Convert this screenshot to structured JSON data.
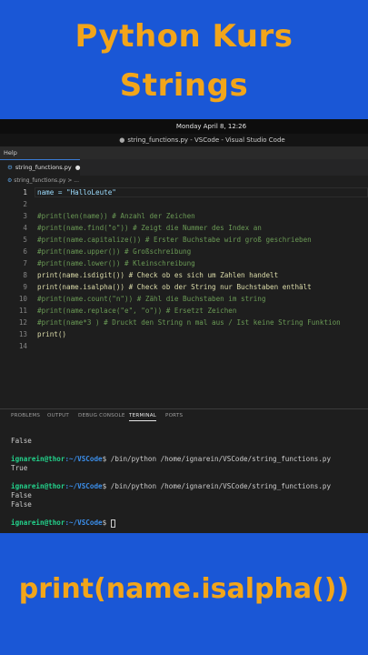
{
  "banner": {
    "line1": "Python Kurs",
    "line2": "Strings",
    "caption": "print(name.isalpha())"
  },
  "os_bar": {
    "datetime": "Monday April 8, 12:26"
  },
  "window": {
    "title": "string_functions.py - VSCode - Visual Studio Code"
  },
  "menu": {
    "help": "Help"
  },
  "tab": {
    "filename": "string_functions.py"
  },
  "breadcrumb": {
    "file": "string_functions.py > ..."
  },
  "editor": {
    "line_numbers": [
      "1",
      "2",
      "3",
      "4",
      "5",
      "6",
      "7",
      "8",
      "9",
      "10",
      "11",
      "12",
      "13",
      "14"
    ],
    "lines": [
      "name = \"HalloLeute\"",
      "",
      "#print(len(name)) # Anzahl der Zeichen",
      "#print(name.find(\"o\")) # Zeigt die Nummer des Index an",
      "#print(name.capitalize()) # Erster Buchstabe wird groß geschrieben",
      "#print(name.upper()) # Großschreibung",
      "#print(name.lower()) # Kleinschreibung",
      "print(name.isdigit()) # Check ob es sich um Zahlen handelt",
      "print(name.isalpha()) # Check ob der String nur Buchstaben enthält",
      "#print(name.count(\"n\")) # Zähl die Buchstaben im string",
      "#print(name.replace(\"e\", \"o\")) # Ersetzt Zeichen",
      "#print(name*3 ) # Druckt den String n mal aus / Ist keine String Funktion",
      "print()",
      ""
    ]
  },
  "panel_tabs": [
    "PROBLEMS",
    "OUTPUT",
    "DEBUG CONSOLE",
    "TERMINAL",
    "PORTS"
  ],
  "terminal": {
    "user": "ignarein@thor",
    "path": ":~/VSCode",
    "prompt_symbol": "$",
    "command": " /bin/python /home/ignarein/VSCode/string_functions.py",
    "out_false": "False",
    "out_true": "True"
  },
  "colors": {
    "background": "#1a57d6",
    "accent_text": "#f2a51a",
    "editor_bg": "#1e1e1e"
  }
}
